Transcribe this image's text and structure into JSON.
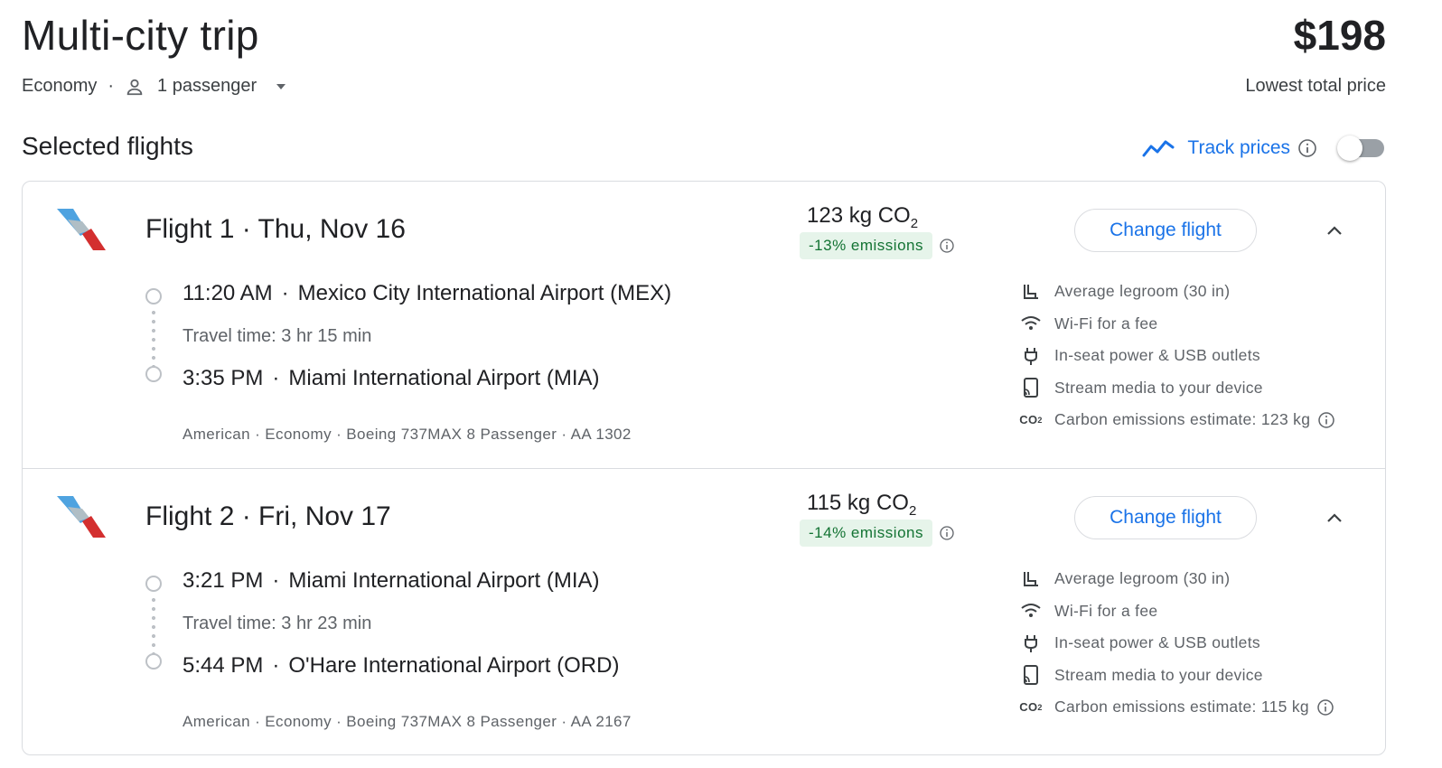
{
  "header": {
    "title": "Multi-city trip",
    "cabin": "Economy",
    "dot": "·",
    "passengers": "1 passenger",
    "price": "$198",
    "price_note": "Lowest total price"
  },
  "selected": {
    "title": "Selected flights",
    "track_label": "Track prices",
    "toggle_on": false
  },
  "colors": {
    "accent": "#1a73e8",
    "emissions_bg": "#e6f4ea",
    "emissions_text": "#137333",
    "airline_blue": "#1976d2",
    "airline_red": "#d32f2f"
  },
  "flights": [
    {
      "title": "Flight 1 · Thu, Nov 16",
      "co2_value": "123 kg CO",
      "co2_sub": "2",
      "emissions_badge": "-13% emissions",
      "change_label": "Change flight",
      "depart_time": "11:20 AM",
      "depart_airport": "Mexico City International Airport (MEX)",
      "travel_time": "Travel time: 3 hr 15 min",
      "arrive_time": "3:35 PM",
      "arrive_airport": "Miami International Airport (MIA)",
      "details": "American · Economy · Boeing 737MAX 8 Passenger · AA 1302",
      "amenities": [
        {
          "icon": "legroom-icon",
          "label": "Average legroom (30 in)"
        },
        {
          "icon": "wifi-icon",
          "label": "Wi-Fi for a fee"
        },
        {
          "icon": "power-icon",
          "label": "In-seat power & USB outlets"
        },
        {
          "icon": "stream-icon",
          "label": "Stream media to your device"
        },
        {
          "icon": "co2-icon",
          "label": "Carbon emissions estimate: 123 kg"
        }
      ]
    },
    {
      "title": "Flight 2 · Fri, Nov 17",
      "co2_value": "115 kg CO",
      "co2_sub": "2",
      "emissions_badge": "-14% emissions",
      "change_label": "Change flight",
      "depart_time": "3:21 PM",
      "depart_airport": "Miami International Airport (MIA)",
      "travel_time": "Travel time: 3 hr 23 min",
      "arrive_time": "5:44 PM",
      "arrive_airport": "O'Hare International Airport (ORD)",
      "details": "American · Economy · Boeing 737MAX 8 Passenger · AA 2167",
      "amenities": [
        {
          "icon": "legroom-icon",
          "label": "Average legroom (30 in)"
        },
        {
          "icon": "wifi-icon",
          "label": "Wi-Fi for a fee"
        },
        {
          "icon": "power-icon",
          "label": "In-seat power & USB outlets"
        },
        {
          "icon": "stream-icon",
          "label": "Stream media to your device"
        },
        {
          "icon": "co2-icon",
          "label": "Carbon emissions estimate: 115 kg"
        }
      ]
    }
  ]
}
